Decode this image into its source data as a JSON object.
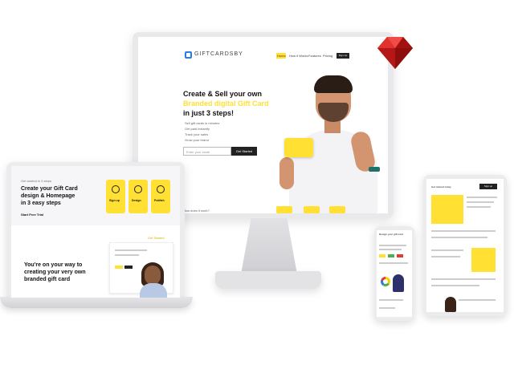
{
  "monitor": {
    "logo_text": "GIFTCARDSBY",
    "nav_items": [
      "Home",
      "How it Works",
      "Features",
      "Pricing"
    ],
    "nav_cta": "Sign Up",
    "hero_line1": "Create & Sell your own",
    "hero_line2": "Branded digital Gift Card",
    "hero_line3": "in just 3 steps!",
    "bullets": [
      "Sell gift cards in minutes",
      "Get paid instantly",
      "Track your sales",
      "Grow your brand"
    ],
    "email_placeholder": "Enter your email",
    "cta_label": "Get Started",
    "bottom_text": "How does it work?"
  },
  "laptop": {
    "kicker": "Get started in 3 steps",
    "headline": [
      "Create your Gift Card",
      "design & Homepage",
      "in 3 easy steps"
    ],
    "link": "Start Free Trial",
    "steps": [
      "Sign up",
      "Design",
      "Publish"
    ],
    "headline2": [
      "You're on your way to",
      "creating your very own",
      "branded gift card"
    ],
    "card_label": "Get Started"
  },
  "phone": {
    "title": "Design your gift card"
  },
  "tablet": {
    "title": "Get started today",
    "cta": "Sign up"
  },
  "colors": {
    "accent": "#ffe033",
    "dark": "#222222",
    "ruby": "#cc1f1f"
  }
}
